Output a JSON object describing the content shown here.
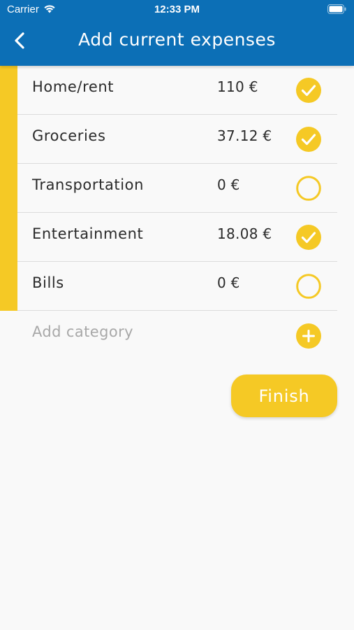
{
  "status_bar": {
    "carrier": "Carrier",
    "time": "12:33 PM",
    "wifi_icon": "wifi-icon",
    "battery_icon": "battery-icon"
  },
  "header": {
    "title": "Add current expenses",
    "back_icon": "chevron-left-icon",
    "background_color": "#0c6fb6"
  },
  "expenses": [
    {
      "label": "Home/rent",
      "amount": "110 €",
      "checked": true
    },
    {
      "label": "Groceries",
      "amount": "37.12 €",
      "checked": true
    },
    {
      "label": "Transportation",
      "amount": "0 €",
      "checked": false
    },
    {
      "label": "Entertainment",
      "amount": "18.08 €",
      "checked": true
    },
    {
      "label": "Bills",
      "amount": "0 €",
      "checked": false
    }
  ],
  "add_category": {
    "placeholder": "Add category",
    "icon": "plus-circle-icon"
  },
  "finish_button": {
    "label": "Finish"
  },
  "colors": {
    "accent": "#f5c925",
    "header": "#0c6fb6",
    "background": "#f9f9f9"
  }
}
